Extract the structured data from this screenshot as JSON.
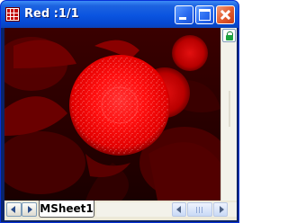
{
  "window": {
    "title": "Red :1/1",
    "controls": {
      "minimize": "minimize",
      "maximize": "maximize",
      "close": "close"
    }
  },
  "image": {
    "channel_color": "#e60000"
  },
  "sheet_tabs": [
    {
      "label": "MSheet1",
      "active": true
    }
  ],
  "colors": {
    "titlebar": "#0a54e0",
    "close_button": "#e25a2c",
    "frame": "#ece9d8",
    "image_background": "#000000"
  }
}
